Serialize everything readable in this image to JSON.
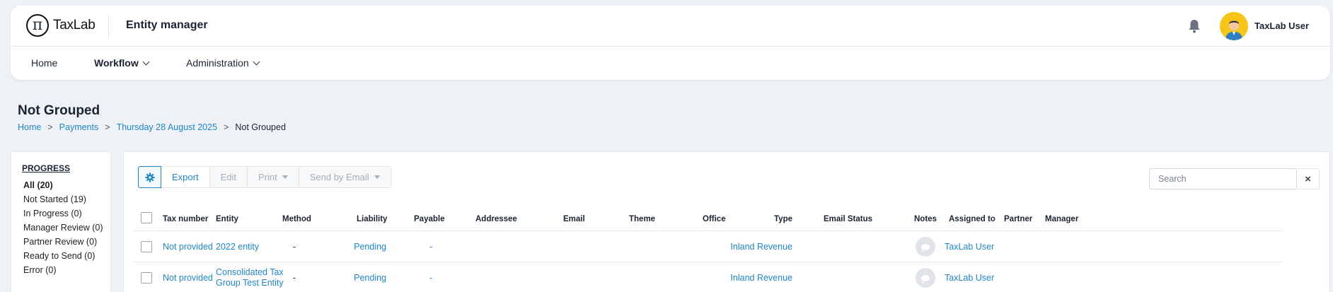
{
  "app": {
    "logo_symbol": "π",
    "logo_text": "TaxLab",
    "title": "Entity manager",
    "user_name": "TaxLab User"
  },
  "nav": {
    "home": "Home",
    "workflow": "Workflow",
    "administration": "Administration"
  },
  "page": {
    "title": "Not Grouped",
    "breadcrumb": [
      "Home",
      "Payments",
      "Thursday 28 August 2025",
      "Not Grouped"
    ],
    "breadcrumb_sep": ">"
  },
  "progress": {
    "heading": "PROGRESS",
    "items": [
      {
        "label": "All (20)",
        "active": true
      },
      {
        "label": "Not Started (19)",
        "active": false
      },
      {
        "label": "In Progress (0)",
        "active": false
      },
      {
        "label": "Manager Review (0)",
        "active": false
      },
      {
        "label": "Partner Review (0)",
        "active": false
      },
      {
        "label": "Ready to Send (0)",
        "active": false
      },
      {
        "label": "Error (0)",
        "active": false
      }
    ]
  },
  "toolbar": {
    "gear_icon": "gear-icon",
    "export": "Export",
    "edit": "Edit",
    "print": "Print",
    "send_by_email": "Send by Email"
  },
  "search": {
    "placeholder": "Search",
    "clear": "×"
  },
  "table": {
    "columns": [
      "Tax number",
      "Entity",
      "Method",
      "Liability",
      "Payable",
      "Addressee",
      "Email",
      "Theme",
      "Office",
      "Type",
      "Email Status",
      "Notes",
      "Assigned to",
      "Partner",
      "Manager"
    ],
    "rows": [
      {
        "tax_number": "Not provided",
        "entity": "2022 entity",
        "method": "-",
        "liability": "Pending",
        "payable": "-",
        "addressee": "",
        "email": "",
        "theme": "",
        "office": "",
        "type": "Inland Revenue",
        "email_status": "",
        "assigned_to": "TaxLab User",
        "partner": "",
        "manager": ""
      },
      {
        "tax_number": "Not provided",
        "entity": "Consolidated Tax Group Test Entity",
        "method": "-",
        "liability": "Pending",
        "payable": "-",
        "addressee": "",
        "email": "",
        "theme": "",
        "office": "",
        "type": "Inland Revenue",
        "email_status": "",
        "assigned_to": "TaxLab User",
        "partner": "",
        "manager": ""
      }
    ]
  },
  "colors": {
    "link": "#1f86c4",
    "avatar_bg": "#f5c518",
    "page_bg": "#eef1f5"
  }
}
